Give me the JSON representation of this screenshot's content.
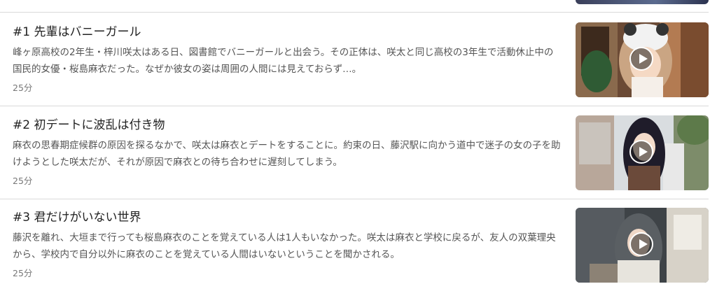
{
  "episodes": [
    {
      "title": "#1 先輩はバニーガール",
      "description": "峰ヶ原高校の2年生・梓川咲太はある日、図書館でバニーガールと出会う。その正体は、咲太と同じ高校の3年生で活動休止中の国民的女優・桜島麻衣だった。なぜか彼女の姿は周囲の人間には見えておらず…。",
      "duration": "25分"
    },
    {
      "title": "#2 初デートに波乱は付き物",
      "description": "麻衣の思春期症候群の原因を探るなかで、咲太は麻衣とデートをすることに。約束の日、藤沢駅に向かう道中で迷子の女の子を助けようとした咲太だが、それが原因で麻衣との待ち合わせに遅刻してしまう。",
      "duration": "25分"
    },
    {
      "title": "#3 君だけがいない世界",
      "description": "藤沢を離れ、大垣まで行っても桜島麻衣のことを覚えている人は1人もいなかった。咲太は麻衣と学校に戻るが、友人の双葉理央から、学校内で自分以外に麻衣のことを覚えている人間はいないということを聞かされる。",
      "duration": "25分"
    }
  ],
  "icons": {
    "play": "play-icon"
  }
}
